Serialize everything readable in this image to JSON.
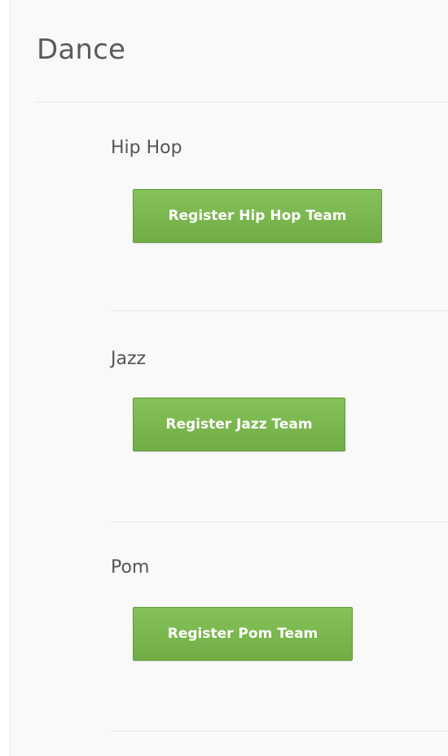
{
  "page": {
    "title": "Dance"
  },
  "sections": [
    {
      "heading": "Hip Hop",
      "button_label": "Register Hip Hop Team"
    },
    {
      "heading": "Jazz",
      "button_label": "Register Jazz Team"
    },
    {
      "heading": "Pom",
      "button_label": "Register Pom Team"
    }
  ],
  "colors": {
    "button_background": "#78b64d",
    "button_text": "#ffffff",
    "heading_text": "#555555",
    "panel_background": "#f9f9f9"
  }
}
